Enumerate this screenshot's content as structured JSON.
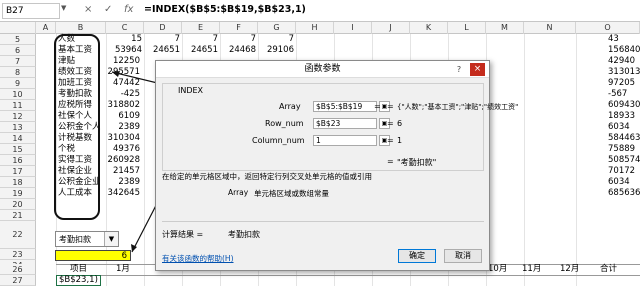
{
  "formula_bar": {
    "name_box": "B27",
    "cancel": "×",
    "enter": "✓",
    "fx": "fx",
    "formula": "=INDEX($B$5:$B$19,$B$23,1)"
  },
  "columns": [
    "A",
    "B",
    "C",
    "D",
    "E",
    "F",
    "G",
    "H",
    "I",
    "J",
    "K",
    "L",
    "M",
    "N",
    "O"
  ],
  "rows": [
    "5",
    "6",
    "7",
    "8",
    "9",
    "10",
    "11",
    "12",
    "13",
    "14",
    "15",
    "16",
    "17",
    "18",
    "19",
    "20",
    "21",
    "22",
    "23",
    "24",
    "25",
    "26",
    "27"
  ],
  "sheet": {
    "b_items": [
      "人数",
      "基本工资",
      "津贴",
      "绩效工资",
      "加班工资",
      "考勤扣款",
      "应税所得",
      "社保个人",
      "公积金个人",
      "计税基数",
      "个税",
      "实得工资",
      "社保企业",
      "公积金企业",
      "人工成本"
    ],
    "row5": {
      "b": "",
      "c": "15",
      "d": "7",
      "e": "7",
      "f": "7",
      "g": "7"
    },
    "row6": {
      "c": "53964",
      "d": "24651",
      "e": "24651",
      "f": "24468",
      "g": "29106"
    },
    "col_b_values": [
      "12250",
      "295571",
      "47442",
      "-425",
      "318802",
      "6109",
      "2389",
      "310304",
      "49376",
      "260928",
      "21457",
      "2389",
      "342645"
    ],
    "col_o_values": [
      "43",
      "156840",
      "42940",
      "313013",
      "97205",
      "-567",
      "609430",
      "18933",
      "6034",
      "584463",
      "75889",
      "508574",
      "70172",
      "6034",
      "685636"
    ],
    "dropdown_value": "考勤扣款",
    "b23_value": "6",
    "b26_label": "项目",
    "c26_label": "1月",
    "b27_value": "$B$23,1)",
    "right_headers": [
      "10月",
      "11月",
      "12月",
      "合计"
    ]
  },
  "dialog": {
    "title": "函数参数",
    "minimize": "?",
    "close": "×",
    "function_name": "INDEX",
    "args": [
      {
        "label": "Array",
        "value": "$B$5:$B$19",
        "result": "{\"人数\";\"基本工资\";\"津贴\";\"绩效工资\""
      },
      {
        "label": "Row_num",
        "value": "$B$23",
        "result": "6"
      },
      {
        "label": "Column_num",
        "value": "1",
        "result": "1"
      }
    ],
    "overall_result": "\"考勤扣款\"",
    "description": "在给定的单元格区域中，返回特定行列交叉处单元格的值或引用",
    "arg_help_name": "Array",
    "arg_help_text": "单元格区域或数组常量",
    "calc_result_label": "计算结果 =",
    "calc_result_value": "考勤扣款",
    "help_link": "有关该函数的帮助(H)",
    "ok": "确定",
    "cancel": "取消"
  }
}
